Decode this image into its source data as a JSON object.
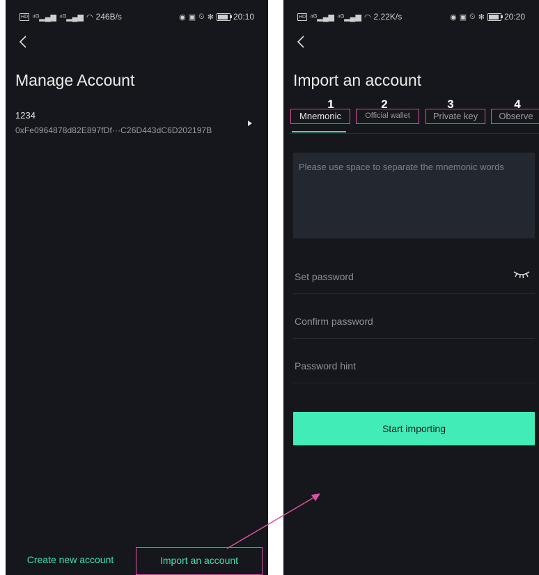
{
  "left_screen": {
    "status_left": "246B/s",
    "status_time": "20:10",
    "title": "Manage Account",
    "account": {
      "name": "1234",
      "address": "0xFe0964878d82E897fDf···C26D443dC6D202197B"
    },
    "create_label": "Create new account",
    "import_label": "Import an account"
  },
  "right_screen": {
    "status_left": "2.22K/s",
    "status_time": "20:20",
    "title": "Import an account",
    "tabs": [
      {
        "num": "1",
        "label": "Mnemonic"
      },
      {
        "num": "2",
        "label": "Official wallet"
      },
      {
        "num": "3",
        "label": "Private key"
      },
      {
        "num": "4",
        "label": "Observe"
      }
    ],
    "mnemonic_placeholder": "Please use space to separate the mnemonic words",
    "set_password_placeholder": "Set password",
    "confirm_password_placeholder": "Confirm password",
    "password_hint_placeholder": "Password hint",
    "start_label": "Start importing"
  },
  "icons": {
    "back": "back-arrow-icon",
    "arrow_right": "triangle-right-icon",
    "eye": "eye-closed-icon"
  },
  "colors": {
    "background": "#16171c",
    "accent": "#42ecb7",
    "accent_text": "#3ce0ae",
    "annotation": "#d9519f"
  }
}
